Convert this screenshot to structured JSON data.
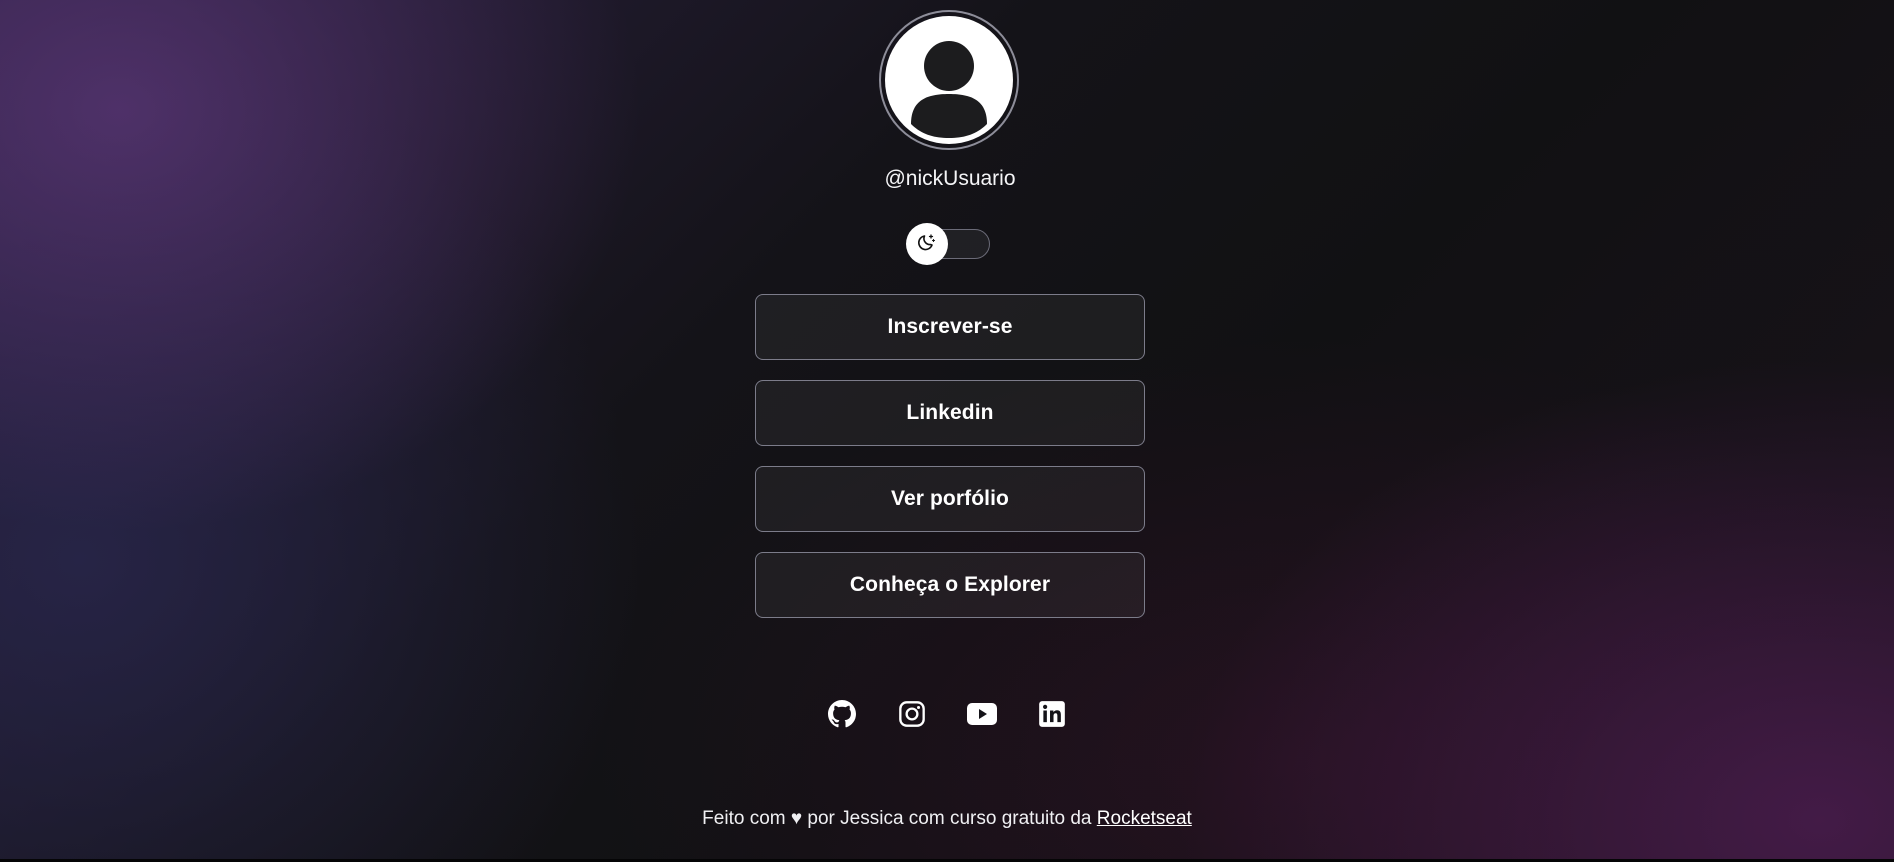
{
  "profile": {
    "username": "@nickUsuario",
    "avatar_icon": "user-avatar-icon"
  },
  "theme_switch": {
    "icon": "moon-icon"
  },
  "links": [
    {
      "label": "Inscrever-se"
    },
    {
      "label": "Linkedin"
    },
    {
      "label": "Ver porfólio"
    },
    {
      "label": "Conheça o Explorer"
    }
  ],
  "social": [
    {
      "icon": "github-icon"
    },
    {
      "icon": "instagram-icon"
    },
    {
      "icon": "youtube-icon"
    },
    {
      "icon": "linkedin-icon"
    }
  ],
  "footer": {
    "text": "Feito com ♥ por Jessica com curso gratuito da",
    "link_label": "Rocketseat"
  },
  "colors": {
    "text": "#ffffff",
    "button_border": "#7c7c8a",
    "background": "#121214",
    "accent_purple": "#5c3778"
  }
}
